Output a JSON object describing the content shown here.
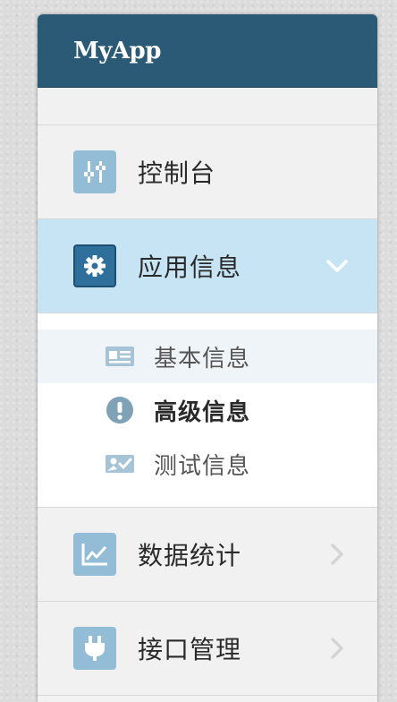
{
  "app": {
    "title": "MyApp"
  },
  "menu": [
    {
      "label": "控制台",
      "icon": "sliders-icon"
    },
    {
      "label": "应用信息",
      "icon": "gear-icon",
      "active": true,
      "submenu": [
        {
          "label": "基本信息",
          "icon": "id-card-icon"
        },
        {
          "label": "高级信息",
          "icon": "exclamation-circle-icon"
        },
        {
          "label": "测试信息",
          "icon": "image-check-icon"
        }
      ]
    },
    {
      "label": "数据统计",
      "icon": "line-chart-icon"
    },
    {
      "label": "接口管理",
      "icon": "plug-icon"
    }
  ],
  "colors": {
    "header": "#2b5a76",
    "active_bg": "#c6e4f4",
    "icon_bg": "#93bcd6",
    "active_icon_bg": "#2f6f9c"
  }
}
